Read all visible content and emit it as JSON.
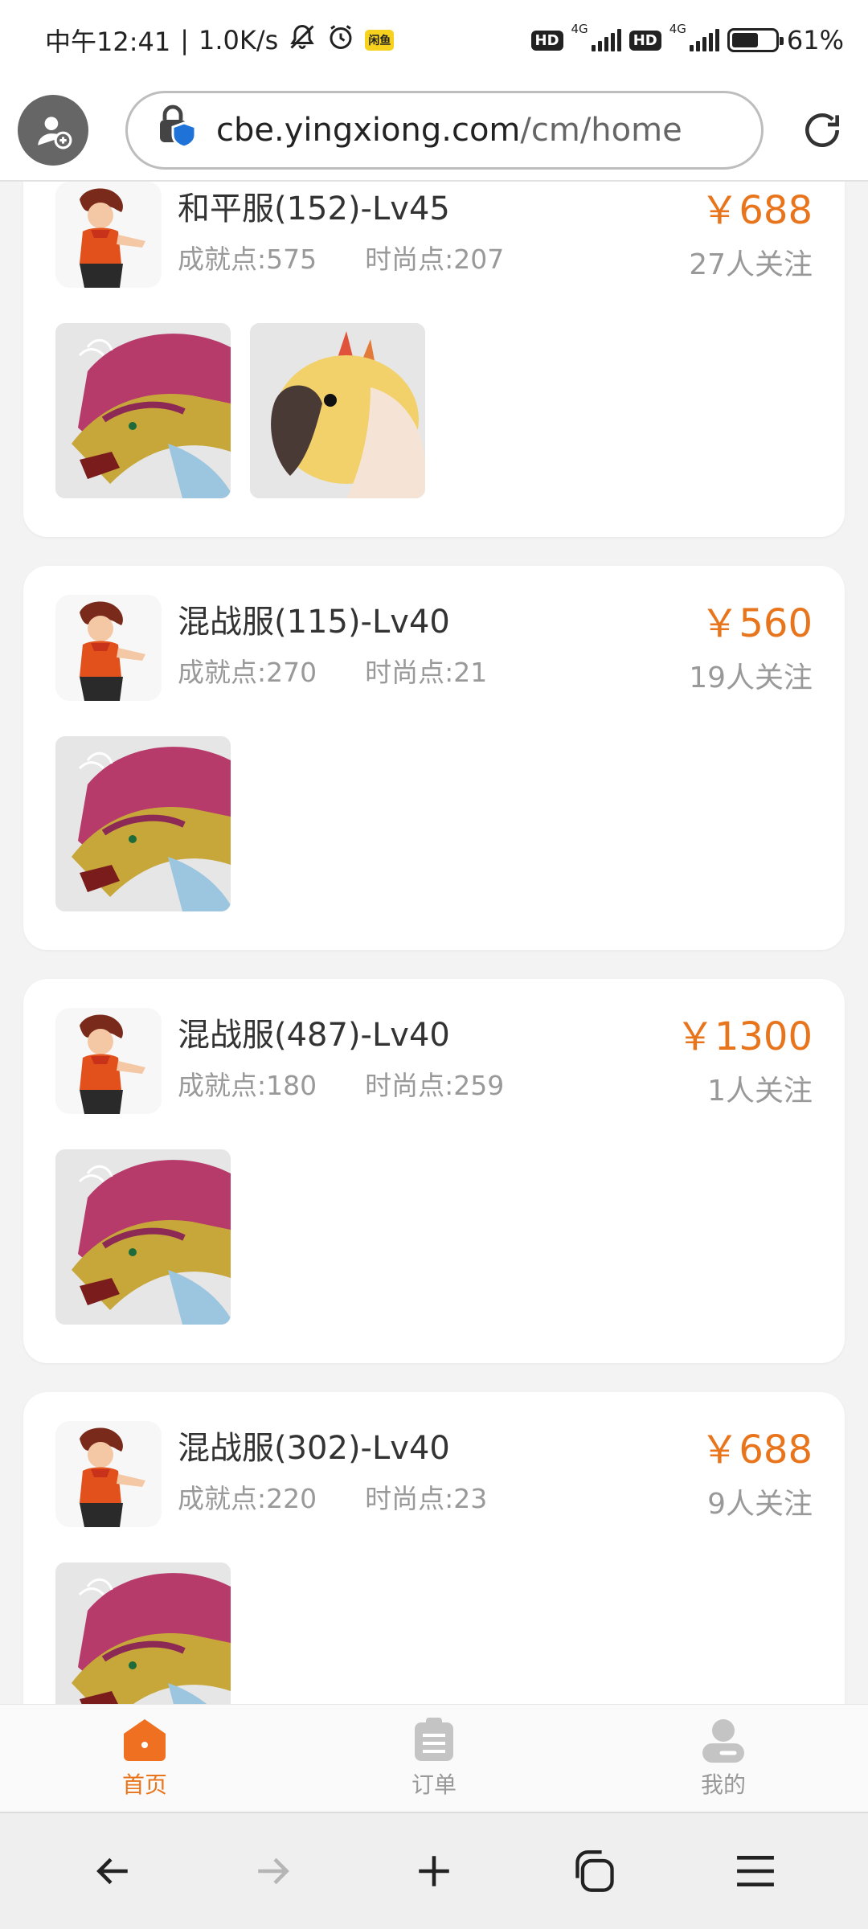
{
  "status_bar": {
    "time": "中午12:41",
    "speed": "1.0K/s",
    "app_badge": "闲鱼",
    "network_left": "HD",
    "network_right": "HD",
    "gen": "4G",
    "battery_level": 0.61,
    "battery": "61%"
  },
  "address_bar": {
    "url_host": "cbe.yingxiong.com",
    "url_path": "/cm/home"
  },
  "listings": [
    {
      "server": "和平服(152)-Lv45",
      "achievement": "成就点:575",
      "fashion": "时尚点:207",
      "price": "￥688",
      "followers": "27人关注",
      "pets": [
        "dragon-pet-icon",
        "bird-pet-icon"
      ]
    },
    {
      "server": "混战服(115)-Lv40",
      "achievement": "成就点:270",
      "fashion": "时尚点:21",
      "price": "￥560",
      "followers": "19人关注",
      "pets": [
        "dragon-pet-icon"
      ]
    },
    {
      "server": "混战服(487)-Lv40",
      "achievement": "成就点:180",
      "fashion": "时尚点:259",
      "price": "￥1300",
      "followers": "1人关注",
      "pets": [
        "dragon-pet-icon"
      ]
    },
    {
      "server": "混战服(302)-Lv40",
      "achievement": "成就点:220",
      "fashion": "时尚点:23",
      "price": "￥688",
      "followers": "9人关注",
      "pets": [
        "dragon-pet-icon"
      ]
    }
  ],
  "tabs": [
    {
      "label": "首页",
      "icon": "home-icon",
      "active": true
    },
    {
      "label": "订单",
      "icon": "clipboard-icon",
      "active": false
    },
    {
      "label": "我的",
      "icon": "user-icon",
      "active": false
    }
  ],
  "browser_toolbar": [
    "back-arrow-icon",
    "forward-arrow-icon",
    "new-tab-plus-icon",
    "tabs-overview-icon",
    "menu-icon"
  ],
  "colors": {
    "accent": "#e8741c",
    "muted": "#999999"
  }
}
